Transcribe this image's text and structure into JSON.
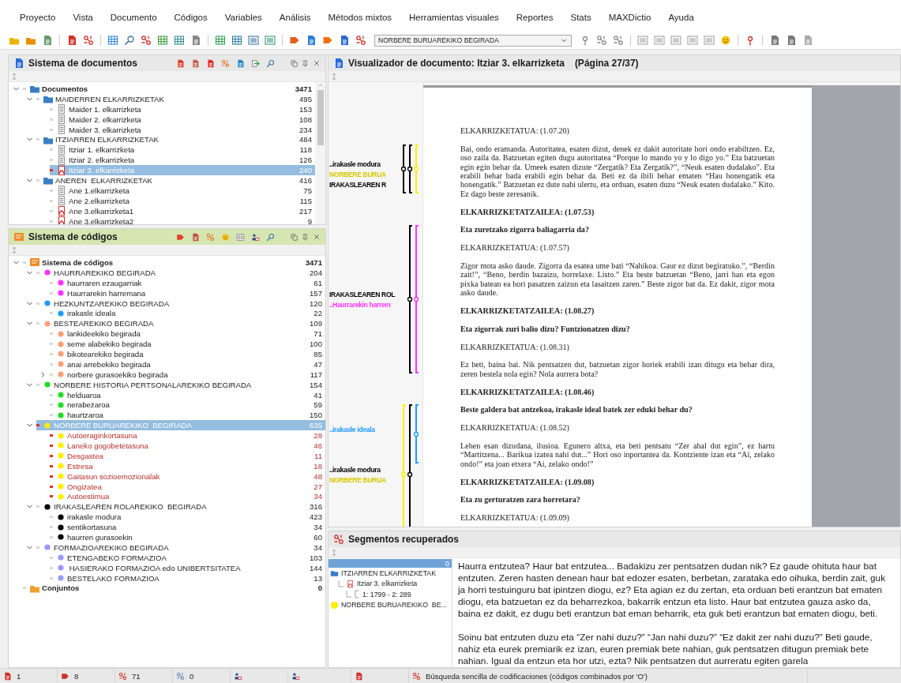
{
  "menu": [
    "Proyecto",
    "Vista",
    "Documento",
    "Códigos",
    "Variables",
    "Análisis",
    "Métodos mixtos",
    "Herramientas visuales",
    "Reportes",
    "Stats",
    "MAXDictio",
    "Ayuda"
  ],
  "toolbar": {
    "code_dropdown": "NORBERE BURUAREKIKO  BEGIRADA"
  },
  "document_system": {
    "title": "Sistema de documentos",
    "tree": [
      {
        "name": "Documentos",
        "count": "3471",
        "kind": "root",
        "expanded": true,
        "selected": false,
        "activated": false,
        "children": [
          {
            "name": "MAIDERREN ELKARRIZKETAK",
            "count": "495",
            "kind": "group",
            "expanded": true,
            "selected": false,
            "activated": false,
            "children": [
              {
                "name": "Maider 1. elkarrizketa",
                "count": "153",
                "kind": "text",
                "selected": false,
                "activated": false
              },
              {
                "name": "Maider 2. elkarrizketa",
                "count": "108",
                "kind": "text",
                "selected": false,
                "activated": false
              },
              {
                "name": "Maider 3. elkarrizketa",
                "count": "234",
                "kind": "text",
                "selected": false,
                "activated": false
              }
            ]
          },
          {
            "name": "ITZIARREN ELKARRIZKETAK",
            "count": "484",
            "kind": "group",
            "expanded": true,
            "selected": false,
            "activated": false,
            "children": [
              {
                "name": "Itziar 1. elkarrizketa",
                "count": "118",
                "kind": "text",
                "selected": false,
                "activated": false
              },
              {
                "name": "Itziar 2. elkarrizketa",
                "count": "126",
                "kind": "text",
                "selected": false,
                "activated": false
              },
              {
                "name": "Itziar 3. elkarrizketa",
                "count": "240",
                "kind": "pdf",
                "selected": true,
                "activated": true
              }
            ]
          },
          {
            "name": "ANEREN  ELKARRIZKETAK",
            "count": "416",
            "kind": "group",
            "expanded": true,
            "selected": false,
            "activated": false,
            "children": [
              {
                "name": "Ane 1.elkarrizketa",
                "count": "75",
                "kind": "text",
                "selected": false,
                "activated": false
              },
              {
                "name": "Ane 2.elkarrizketa",
                "count": "115",
                "kind": "text",
                "selected": false,
                "activated": false
              },
              {
                "name": "Ane 3.elkarrizketa1",
                "count": "217",
                "kind": "pdf",
                "selected": false,
                "activated": false
              },
              {
                "name": "Ane 3.elkarrizketa2",
                "count": "9",
                "kind": "pdf",
                "selected": false,
                "activated": false
              }
            ]
          }
        ]
      }
    ]
  },
  "code_system": {
    "title": "Sistema de códigos",
    "tree": [
      {
        "name": "Sistema de códigos",
        "count": "3471",
        "kind": "root",
        "expanded": true,
        "selected": false,
        "activated": false,
        "children": [
          {
            "name": "HAURRAREKIKO BEGIRADA",
            "count": "204",
            "kind": "code",
            "color": "#ff33ff",
            "expanded": true,
            "selected": false,
            "activated": false,
            "children": [
              {
                "name": "haurraren ezaugarriak",
                "count": "61",
                "kind": "code",
                "color": "#ff33ff",
                "selected": false,
                "activated": false
              },
              {
                "name": "Haurrarekin harremana",
                "count": "157",
                "kind": "code",
                "color": "#ff33ff",
                "selected": false,
                "activated": false
              }
            ]
          },
          {
            "name": "HEZKUNTZAREKIKO BEGIRADA",
            "count": "120",
            "kind": "code",
            "color": "#1e9bff",
            "expanded": true,
            "selected": false,
            "activated": false,
            "children": [
              {
                "name": "irakasle ideala",
                "count": "22",
                "kind": "code",
                "color": "#1e9bff",
                "selected": false,
                "activated": false
              }
            ]
          },
          {
            "name": "BESTEAREKIKO BEGIRADA",
            "count": "109",
            "kind": "code",
            "color": "#ff9f7a",
            "expanded": true,
            "selected": false,
            "activated": false,
            "children": [
              {
                "name": "lankideekiko begirada",
                "count": "71",
                "kind": "code",
                "color": "#ff9f7a",
                "selected": false,
                "activated": false
              },
              {
                "name": "seme alabekiko begirada",
                "count": "100",
                "kind": "code",
                "color": "#ff9f7a",
                "selected": false,
                "activated": false
              },
              {
                "name": "bikotearekiko begirada",
                "count": "85",
                "kind": "code",
                "color": "#ff9f7a",
                "selected": false,
                "activated": false
              },
              {
                "name": "anai arrebekiko begirada",
                "count": "47",
                "kind": "code",
                "color": "#ff9f7a",
                "selected": false,
                "activated": false
              },
              {
                "name": "norbere gurasoekiko begirada",
                "count": "117",
                "kind": "code",
                "color": "#ff9f7a",
                "expanded": false,
                "selected": false,
                "activated": false
              }
            ]
          },
          {
            "name": "NORBERE HISTORIA PERTSONALAREKIKO BEGIRADA",
            "count": "154",
            "kind": "code",
            "color": "#22dd22",
            "expanded": true,
            "selected": false,
            "activated": false,
            "children": [
              {
                "name": "helduaroa",
                "count": "41",
                "kind": "code",
                "color": "#22dd22",
                "selected": false,
                "activated": false
              },
              {
                "name": "nerabezaroa",
                "count": "59",
                "kind": "code",
                "color": "#22dd22",
                "selected": false,
                "activated": false
              },
              {
                "name": "haurtzaroa",
                "count": "150",
                "kind": "code",
                "color": "#22dd22",
                "selected": false,
                "activated": false
              }
            ]
          },
          {
            "name": "NORBERE BURUAREKIKO  BEGIRADA",
            "count": "635",
            "kind": "code",
            "color": "#ffee00",
            "expanded": true,
            "selected": true,
            "activated": true,
            "children": [
              {
                "name": "Autoeraginkortasuna",
                "count": "28",
                "kind": "code",
                "color": "#ffee00",
                "selected": false,
                "activated": true
              },
              {
                "name": "Laneko gogobetetasuna",
                "count": "46",
                "kind": "code",
                "color": "#ffee00",
                "selected": false,
                "activated": true
              },
              {
                "name": "Desgastea",
                "count": "11",
                "kind": "code",
                "color": "#ffee00",
                "selected": false,
                "activated": true
              },
              {
                "name": "Estresa",
                "count": "18",
                "kind": "code",
                "color": "#ffee00",
                "selected": false,
                "activated": true
              },
              {
                "name": "Gaitasun sozioemozionalak",
                "count": "48",
                "kind": "code",
                "color": "#ffee00",
                "selected": false,
                "activated": true
              },
              {
                "name": "Ongizatea",
                "count": "27",
                "kind": "code",
                "color": "#ffee00",
                "selected": false,
                "activated": true
              },
              {
                "name": "Autoestimua",
                "count": "34",
                "kind": "code",
                "color": "#ffee00",
                "selected": false,
                "activated": true
              }
            ]
          },
          {
            "name": "IRAKASLEAREN ROLAREKIKO  BEGIRADA",
            "count": "316",
            "kind": "code",
            "color": "#000000",
            "expanded": true,
            "selected": false,
            "activated": false,
            "children": [
              {
                "name": "irakasle modura",
                "count": "423",
                "kind": "code",
                "color": "#000000",
                "selected": false,
                "activated": false
              },
              {
                "name": "sentikortasuna",
                "count": "34",
                "kind": "code",
                "color": "#000000",
                "selected": false,
                "activated": false
              },
              {
                "name": "haurren gurasoekin",
                "count": "60",
                "kind": "code",
                "color": "#000000",
                "selected": false,
                "activated": false
              }
            ]
          },
          {
            "name": "FORMAZIOAREKIKO BEGIRADA",
            "count": "34",
            "kind": "code",
            "color": "#9999ff",
            "expanded": true,
            "selected": false,
            "activated": false,
            "children": [
              {
                "name": "ETENGABEKO FORMAZIOA",
                "count": "103",
                "kind": "code",
                "color": "#9999ff",
                "selected": false,
                "activated": false
              },
              {
                "name": " HASIERAKO FORMAZIOA edo UNIBERTSITATEA",
                "count": "144",
                "kind": "code",
                "color": "#9999ff",
                "selected": false,
                "activated": false
              },
              {
                "name": "BESTELAKO FORMAZIOA",
                "count": "13",
                "kind": "code",
                "color": "#9999ff",
                "selected": false,
                "activated": false
              }
            ]
          }
        ]
      },
      {
        "name": "Conjuntos",
        "count": "0",
        "kind": "sets",
        "selected": false,
        "activated": false
      }
    ]
  },
  "document_viewer": {
    "title": "Visualizador de documento: Itziar 3. elkarrizketa",
    "page": "(Página 27/37)",
    "margin_codes": [
      {
        "labels": [
          {
            "text": "..irakasle modura",
            "color": "#000000"
          },
          {
            "text": "NORBERE BURUA",
            "color": "#d8c800"
          },
          {
            "text": "IRAKASLEAREN R",
            "color": "#000000"
          }
        ],
        "bars": [
          {
            "color": "#000000"
          },
          {
            "color": "#000000"
          },
          {
            "color": "#ffee00"
          }
        ]
      },
      {
        "labels": [
          {
            "text": "IRAKASLEAREN ROL",
            "color": "#000000"
          },
          {
            "text": "..Haurrarekin harrem",
            "color": "#ff33ff"
          }
        ],
        "bars": [
          {
            "color": "#000000"
          },
          {
            "color": "#ff33ff"
          }
        ]
      },
      {
        "labels": [
          {
            "text": "..irakasle ideala",
            "color": "#1e9bff"
          },
          {
            "text": "..irakasle modura",
            "color": "#000000"
          },
          {
            "text": "NORBERE BURUA",
            "color": "#d8c800"
          }
        ],
        "bars": [
          {
            "color": "#ffee00"
          },
          {
            "color": "#000000"
          },
          {
            "color": "#1e9bff"
          }
        ]
      }
    ],
    "blocks": [
      {
        "kind": "label",
        "text": "ELKARRIZKETATUA: (1.07.20)"
      },
      {
        "kind": "paragraph",
        "text": "Bai, ondo eramanda. Autoritatea, esaten dizut, denek ez dakit autoritate hori ondo erabiltzen. Ez, oso zaila da. Batzuetan egiten dugu autoritatea “Porque lo mando yo y lo digo yo.” Eta batzuetan egin egin behar da. Umeek esaten dizute “Zergatik? Eta Zergatik?”, “Neuk esaten dudalako”. Eta erabili behar bada erabili egin behar da. Beti ez da ibili behar ematen “Hau honengatik eta honengatik.” Batzuetan ez dute nahi ulertu, eta orduan, esaten duzu “Neuk esaten dudalako.” Kito. Ez dago beste zeresanik."
      },
      {
        "kind": "heading",
        "text": "ELKARRIZKETATZAILEA: (1.07.53)"
      },
      {
        "kind": "heading",
        "text": "Eta zuretzako zigorra baliagarria da?"
      },
      {
        "kind": "label",
        "text": "ELKARRIZKETATUA: (1.07.57)"
      },
      {
        "kind": "paragraph",
        "text": "Zigor mota asko daude. Zigorra da esatea ume bati “Nahikoa. Gaur ez dizut begiratuko.”, “Berdin zait!”, “Beno, berdin bazaizu, horrelaxe. Listo.” Eta beste batzuetan “Beno, jarri han eta egon pixka batean ea hori pasatzen zaizun eta lasaitzen zaren.” Beste zigor bat da. Ez dakit, zigor mota asko daude."
      },
      {
        "kind": "heading",
        "text": "ELKARRIZKETATZAILEA: (1.08.27)"
      },
      {
        "kind": "heading",
        "text": "Eta zigorrak zuri balio dizu? Funtzionatzen dizu?"
      },
      {
        "kind": "label",
        "text": "ELKARRIZKETATUA: (1.08.31)"
      },
      {
        "kind": "paragraph",
        "text": "Ez beti, baina bai. Nik pentsatzen dut, batzuetan zigor horiek erabili izan ditugu eta behar dira, zeren bestela nola egin? Nola aurrera bota?"
      },
      {
        "kind": "heading",
        "text": "ELKARRIZKETATZAILEA: (1.08.46)"
      },
      {
        "kind": "heading",
        "text": "Beste galdera bat antzekoa, irakasle ideal batek zer eduki behar du?"
      },
      {
        "kind": "label",
        "text": "ELKARRIZKETATUA: (1.08.52)"
      },
      {
        "kind": "paragraph",
        "text": "Lehen esan dizudana, ilusioa. Egunero altxa, eta beti pentsatu “Zer ahal dut egin”, ez hartu “Martitzena... Barikua izatea nahi dut...” Hori oso inportantea da. Kontziente izan eta “Ai, zelako ondo!” eta joan etxera “Ai, zelako ondo!”"
      },
      {
        "kind": "heading",
        "text": "ELKARRIZKETATZAILEA: (1.09.08)"
      },
      {
        "kind": "heading",
        "text": "Eta zu gerturatzen zara horretara?"
      },
      {
        "kind": "label",
        "text": "ELKARRIZKETATUA: (1.09.09)"
      }
    ]
  },
  "retrieved_segments": {
    "title": "Segmentos recuperados",
    "header_row": {
      "count": "0",
      "selected": true
    },
    "tree": [
      {
        "name": "ITZIARREN ELKARRIZKETAK",
        "kind": "group",
        "children": [
          {
            "name": "Itziar 3. elkarrizketa",
            "kind": "document",
            "children": [
              {
                "name": "1: 1799 - 2: 289",
                "kind": "range"
              }
            ]
          }
        ]
      },
      {
        "name": "NORBERE BURUAREKIKO  BE...",
        "kind": "code",
        "color": "#ffee00"
      }
    ],
    "paragraphs": [
      "Haurra entzutea? Haur bat entzutea... Badakizu zer pentsatzen dudan nik? Ez gaude ohituta haur bat entzuten. Zeren hasten denean haur bat edozer esaten, berbetan, zarataka edo oihuka, berdin zait, guk ja horri testuinguru bat ipintzen diogu, ez? Eta agian ez du zertan, eta orduan beti erantzun bat ematen diogu, eta batzuetan ez da beharrezkoa, bakarrik entzun eta listo. Haur bat entzutea gauza asko da, baina ez dakit, ez dugu beti erantzun bat eman beharrik, eta guk beti erantzun bat ematen diogu, beti.",
      "Soinu bat entzuten duzu eta “Zer nahi duzu?” “Jan nahi duzu?” “Ez dakit zer nahi duzu?” Beti gaude, nahiz eta eurek premiarik ez izan, euren premiak bete nahian, guk pentsatzen ditugun premiak bete nahian. Igual da entzun eta hor utzi, ezta? Nik pentsatzen dut aurreratu egiten garela"
    ]
  },
  "status_bar": {
    "documents": "1",
    "codes": "8",
    "segments": "71",
    "memos": "0",
    "search_mode": "Búsqueda sencilla de codificaciones (códigos combinados por 'O')"
  }
}
